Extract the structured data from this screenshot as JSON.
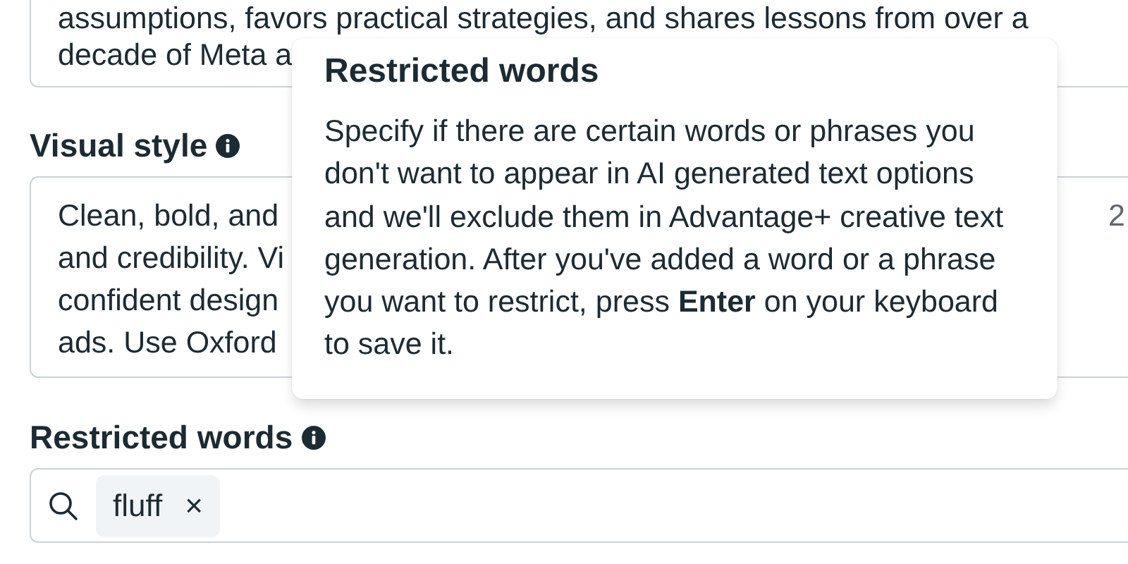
{
  "description_field": {
    "lines": [
      "assumptions, favors practical strategies, and shares lessons from over a",
      "decade of Meta a"
    ]
  },
  "visual_style": {
    "label": "Visual style",
    "lines": [
      "Clean, bold, and",
      "and credibility. Vi",
      "confident design",
      "ads. Use Oxford"
    ],
    "count": "2"
  },
  "restricted_words": {
    "label": "Restricted words",
    "tags": [
      {
        "text": "fluff",
        "remove": "×"
      }
    ]
  },
  "tooltip": {
    "title": "Restricted words",
    "text": "Specify if there are certain words or phrases you don't want to appear in AI generated text options and we'll exclude them in Advantage+ creative text generation. After you've added a word or a phrase you want to restrict, press **Enter** on your keyboard to save it."
  }
}
